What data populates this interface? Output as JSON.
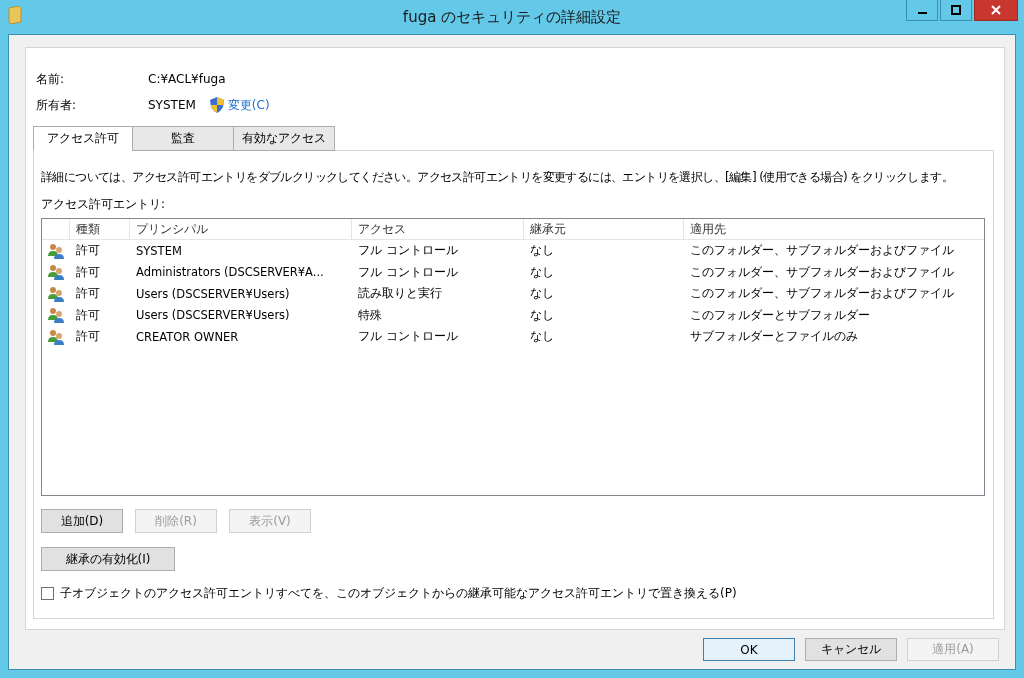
{
  "window": {
    "title": "fuga のセキュリティの詳細設定"
  },
  "name": {
    "label": "名前:",
    "value": "C:¥ACL¥fuga"
  },
  "owner": {
    "label": "所有者:",
    "value": "SYSTEM",
    "change_link": "変更(C)"
  },
  "tabs": [
    {
      "label": "アクセス許可",
      "selected": true
    },
    {
      "label": "監査",
      "selected": false
    },
    {
      "label": "有効なアクセス",
      "selected": false
    }
  ],
  "description": "詳細については、アクセス許可エントリをダブルクリックしてください。アクセス許可エントリを変更するには、エントリを選択し、[編集] (使用できる場合) をクリックします。",
  "entries_label": "アクセス許可エントリ:",
  "table": {
    "columns": [
      "種類",
      "プリンシパル",
      "アクセス",
      "継承元",
      "適用先"
    ],
    "rows": [
      {
        "type": "許可",
        "principal": "SYSTEM",
        "access": "フル コントロール",
        "inherited_from": "なし",
        "applies_to": "このフォルダー、サブフォルダーおよびファイル"
      },
      {
        "type": "許可",
        "principal": "Administrators (DSCSERVER¥A...",
        "access": "フル コントロール",
        "inherited_from": "なし",
        "applies_to": "このフォルダー、サブフォルダーおよびファイル"
      },
      {
        "type": "許可",
        "principal": "Users (DSCSERVER¥Users)",
        "access": "読み取りと実行",
        "inherited_from": "なし",
        "applies_to": "このフォルダー、サブフォルダーおよびファイル"
      },
      {
        "type": "許可",
        "principal": "Users (DSCSERVER¥Users)",
        "access": "特殊",
        "inherited_from": "なし",
        "applies_to": "このフォルダーとサブフォルダー"
      },
      {
        "type": "許可",
        "principal": "CREATOR OWNER",
        "access": "フル コントロール",
        "inherited_from": "なし",
        "applies_to": "サブフォルダーとファイルのみ"
      }
    ]
  },
  "entry_buttons": [
    {
      "label": "追加(D)",
      "disabled": false
    },
    {
      "label": "削除(R)",
      "disabled": true
    },
    {
      "label": "表示(V)",
      "disabled": true
    }
  ],
  "inheritance_button": {
    "label": "継承の有効化(I)",
    "disabled": false
  },
  "replace_checkbox": {
    "label": "子オブジェクトのアクセス許可エントリすべてを、このオブジェクトからの継承可能なアクセス許可エントリで置き換える(P)",
    "checked": false
  },
  "dialog_buttons": [
    {
      "label": "OK",
      "disabled": false,
      "default": true
    },
    {
      "label": "キャンセル",
      "disabled": false,
      "default": false
    },
    {
      "label": "適用(A)",
      "disabled": true,
      "default": false
    }
  ]
}
